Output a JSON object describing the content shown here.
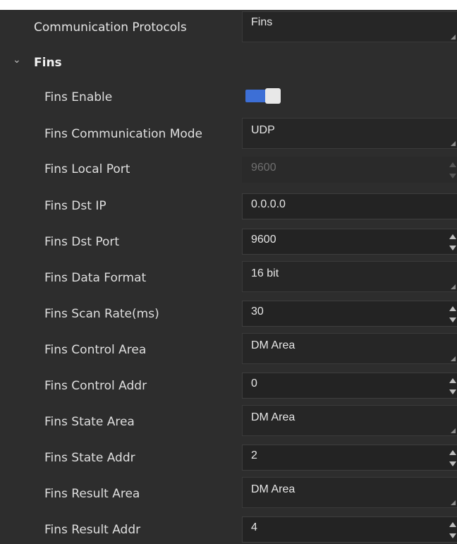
{
  "protocol": {
    "label": "Communication Protocols",
    "value": "Fins"
  },
  "group": {
    "label": "Fins",
    "expanded": true
  },
  "rows": [
    {
      "label": "Fins Enable",
      "type": "toggle",
      "on": true
    },
    {
      "label": "Fins Communication Mode",
      "type": "select",
      "value": "UDP"
    },
    {
      "label": "Fins Local Port",
      "type": "spin",
      "value": "9600",
      "disabled": true
    },
    {
      "label": "Fins Dst IP",
      "type": "text",
      "value": "0.0.0.0"
    },
    {
      "label": "Fins Dst Port",
      "type": "spin",
      "value": "9600"
    },
    {
      "label": "Fins Data Format",
      "type": "select",
      "value": "16 bit"
    },
    {
      "label": "Fins Scan Rate(ms)",
      "type": "spin",
      "value": "30"
    },
    {
      "label": "Fins Control Area",
      "type": "select",
      "value": "DM Area"
    },
    {
      "label": "Fins Control Addr",
      "type": "spin",
      "value": "0"
    },
    {
      "label": "Fins State Area",
      "type": "select",
      "value": "DM Area"
    },
    {
      "label": "Fins State Addr",
      "type": "spin",
      "value": "2"
    },
    {
      "label": "Fins Result Area",
      "type": "select",
      "value": "DM Area"
    },
    {
      "label": "Fins Result Addr",
      "type": "spin",
      "value": "4"
    }
  ],
  "colors": {
    "accent": "#3d6fd6",
    "background": "#2d2d2d"
  },
  "icons": {
    "collapse": "chevron-down-icon"
  }
}
